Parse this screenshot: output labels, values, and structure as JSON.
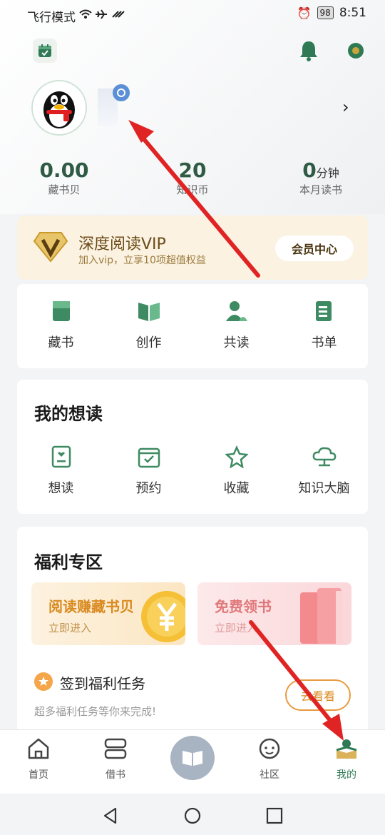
{
  "status_bar": {
    "left": "飞行模式",
    "battery": "98",
    "time": "8:51"
  },
  "stats": [
    {
      "value": "0.00",
      "label": "藏书贝"
    },
    {
      "value": "20",
      "label": "知识币"
    },
    {
      "value": "0",
      "unit": "分钟",
      "label": "本月读书"
    }
  ],
  "vip": {
    "title": "深度阅读VIP",
    "subtitle": "加入vip，立享10项超值权益",
    "button": "会员中心"
  },
  "shelf_grid": [
    {
      "label": "藏书",
      "icon": "book-icon"
    },
    {
      "label": "创作",
      "icon": "open-book-icon"
    },
    {
      "label": "共读",
      "icon": "people-icon"
    },
    {
      "label": "书单",
      "icon": "list-icon"
    }
  ],
  "want_read": {
    "title": "我的想读",
    "items": [
      {
        "label": "想读",
        "icon": "heart-doc-icon"
      },
      {
        "label": "预约",
        "icon": "calendar-check-icon"
      },
      {
        "label": "收藏",
        "icon": "star-icon"
      },
      {
        "label": "知识大脑",
        "icon": "cloud-brain-icon"
      }
    ]
  },
  "welfare": {
    "title": "福利专区",
    "promo_left": {
      "title": "阅读赚藏书贝",
      "subtitle": "立即进入"
    },
    "promo_right": {
      "title": "免费领书",
      "subtitle": "立即进入"
    },
    "task_title": "签到福利任务",
    "task_subtitle": "超多福利任务等你来完成!",
    "task_button": "去看看"
  },
  "tabs": [
    {
      "label": "首页",
      "icon": "home-icon"
    },
    {
      "label": "借书",
      "icon": "borrow-icon"
    },
    {
      "label": "",
      "icon": "center-book-icon"
    },
    {
      "label": "社区",
      "icon": "community-icon"
    },
    {
      "label": "我的",
      "icon": "me-icon"
    }
  ],
  "colors": {
    "accent": "#2f7a55",
    "vip_bg": "#fbf2e1",
    "arrow": "#e02424"
  }
}
